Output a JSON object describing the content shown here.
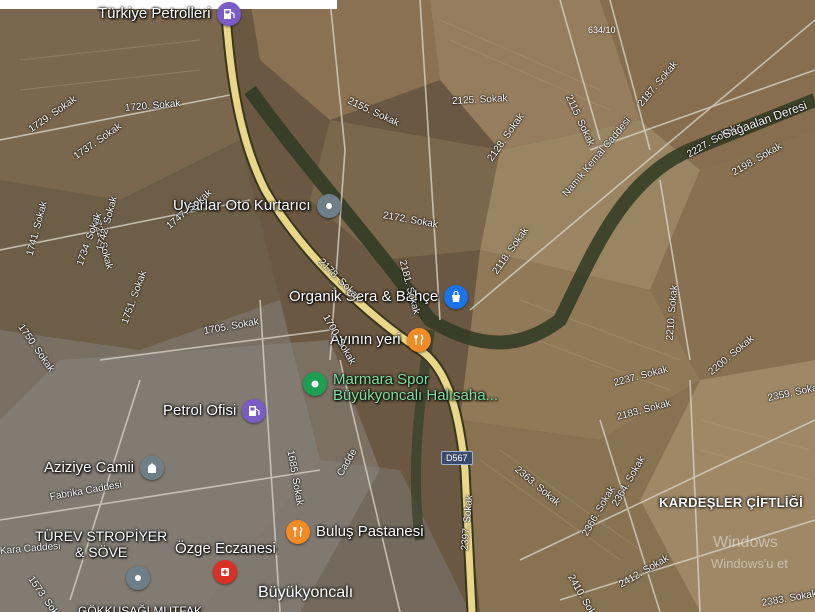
{
  "colors": {
    "pin_grey": "#6f7f8a",
    "pin_blue": "#1a73e8",
    "pin_orange": "#f08b26",
    "pin_green": "#1e9e50",
    "pin_purple": "#7a5cc6",
    "pin_red": "#d93025",
    "highway": "#e8d788"
  },
  "pois": [
    {
      "name": "Türkiye Petrolleri",
      "icon": "fuel-icon",
      "color": "#7a5cc6"
    },
    {
      "name": "Uyarlar Oto Kurtarıcı",
      "icon": "pin-icon",
      "color": "#6f7f8a"
    },
    {
      "name": "Organik Sera & Bahçe",
      "icon": "shopping-bag-icon",
      "color": "#1a73e8"
    },
    {
      "name": "Ayının yeri",
      "icon": "restaurant-icon",
      "color": "#f08b26"
    },
    {
      "name": "Marmara Spor",
      "name2": "Büyükyoncalı Halısaha...",
      "icon": "park-icon",
      "color": "#1e9e50"
    },
    {
      "name": "Petrol Ofisi",
      "icon": "fuel-icon",
      "color": "#7a5cc6"
    },
    {
      "name": "Aziziye Camii",
      "icon": "mosque-icon",
      "color": "#6f7f8a"
    },
    {
      "name": "Buluş Pastanesi",
      "icon": "restaurant-icon",
      "color": "#f08b26"
    },
    {
      "name": "TÜREV STROPİYER",
      "name2": "& SÖVE",
      "icon": "none",
      "color": "none"
    },
    {
      "name": "Özge Eczanesi",
      "icon": "pharmacy-icon",
      "color": "#d93025"
    },
    {
      "name": "",
      "icon": "pin-icon",
      "color": "#6f7f8a"
    }
  ],
  "streets": [
    "2155. Sokak",
    "2125. Sokak",
    "2115. Sokak",
    "2187. Sokak",
    "2227. Sokak",
    "1720. Sokak",
    "1729. Sokak",
    "1737. Sokak",
    "2128. Sokak",
    "2172. Sokak",
    "2178. Sokak",
    "2181. Sokak",
    "1722. Sokak",
    "1741. Sokak",
    "1747. Sokak",
    "1734. Sokak",
    "1742. Sokak",
    "2118. Sokak",
    "1750. Sokak",
    "1751. Sokak",
    "1705. Sokak",
    "1700. Sokak",
    "2200. Sokak",
    "2237. Sokak",
    "2359. Sokak",
    "2183. Sokak",
    "2363. Sokak",
    "2364. Sokak",
    "2366. Sokak",
    "2397. Sokak",
    "2410. Sokak",
    "2412. Sokak",
    "2383. Sokak",
    "1573. Sokak",
    "1685. Sokak",
    "2198. Sokak",
    "2210. Sokak",
    "Kara Caddesi",
    "Fabrika Caddesi",
    "Namık Kemal Caddesi",
    "Sağaalan Deresi",
    "Cadde"
  ],
  "road_shields": {
    "d567": "D567",
    "a634": "634/10"
  },
  "place_names": {
    "town": "Büyükyoncalı",
    "farm": "KARDEŞLER ÇİFTLİĞİ",
    "bottom_poi": "GÖKKUŞAĞI MUTFAK"
  },
  "watermark": {
    "line1": "Windows",
    "line2": "Windows'u et"
  }
}
